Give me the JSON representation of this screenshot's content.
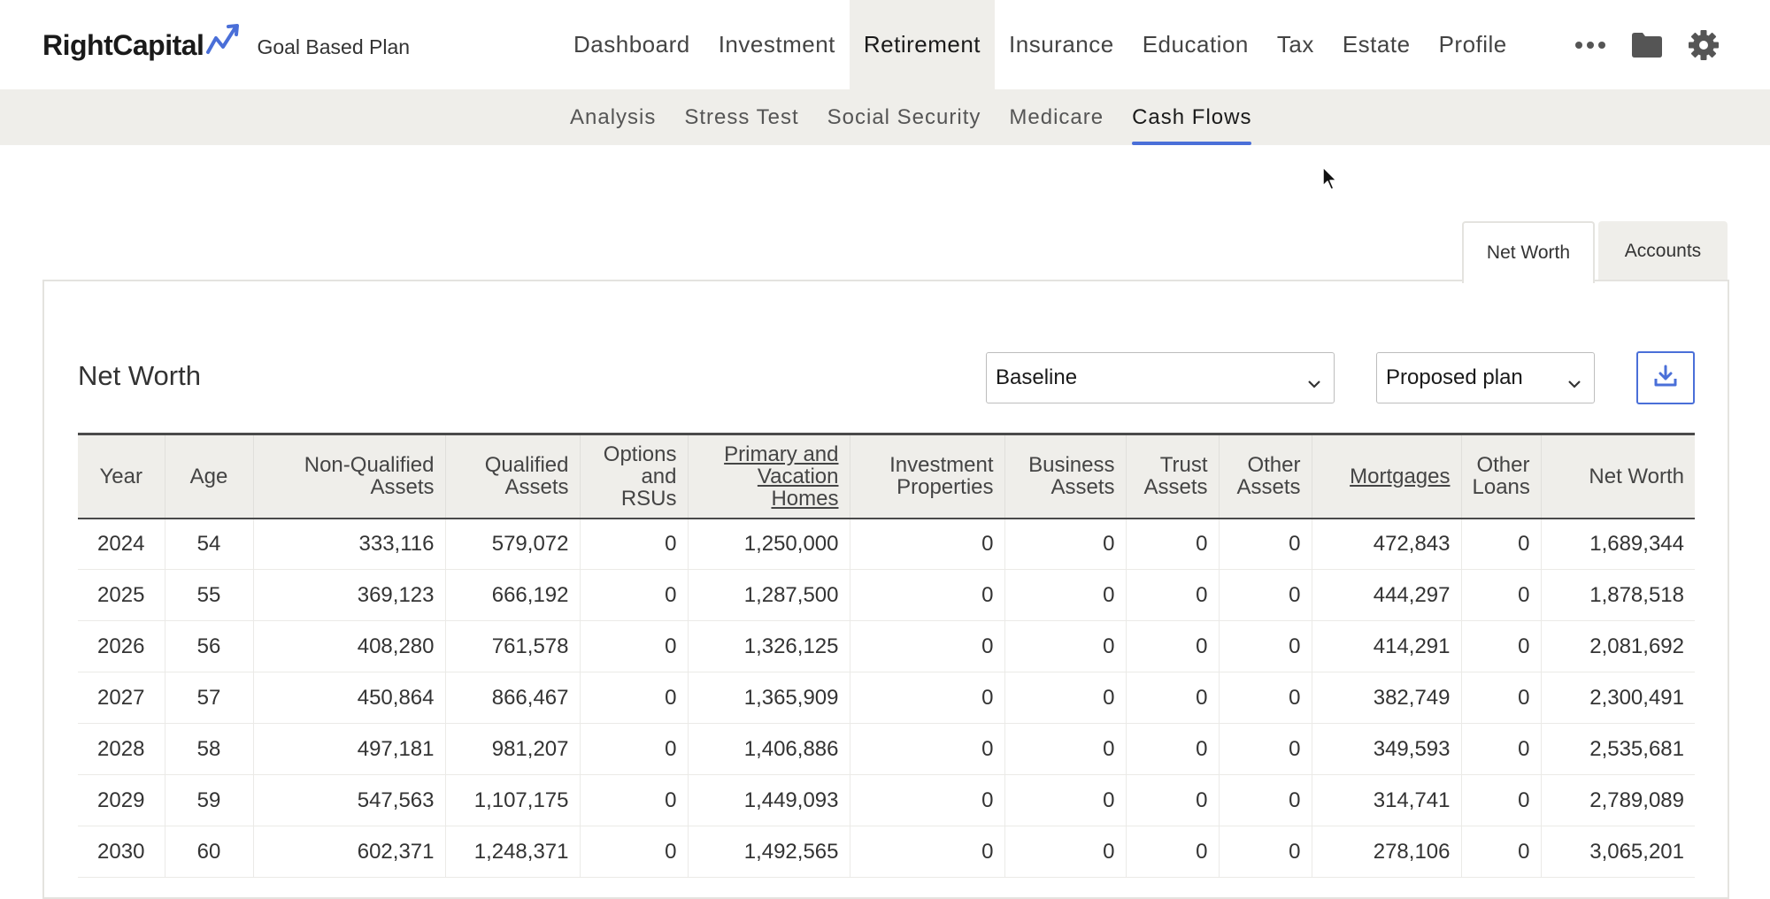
{
  "brand": {
    "logo_text": "RightCapital",
    "plan_name": "Goal Based Plan"
  },
  "main_nav": [
    {
      "label": "Dashboard",
      "active": false
    },
    {
      "label": "Investment",
      "active": false
    },
    {
      "label": "Retirement",
      "active": true
    },
    {
      "label": "Insurance",
      "active": false
    },
    {
      "label": "Education",
      "active": false
    },
    {
      "label": "Tax",
      "active": false
    },
    {
      "label": "Estate",
      "active": false
    },
    {
      "label": "Profile",
      "active": false
    }
  ],
  "nav_icons": [
    "more-icon",
    "folder-icon",
    "gear-icon"
  ],
  "sub_nav": [
    {
      "label": "Analysis",
      "active": false
    },
    {
      "label": "Stress Test",
      "active": false
    },
    {
      "label": "Social Security",
      "active": false
    },
    {
      "label": "Medicare",
      "active": false
    },
    {
      "label": "Cash Flows",
      "active": true
    }
  ],
  "panel_tabs": [
    {
      "label": "Net Worth",
      "active": true
    },
    {
      "label": "Accounts",
      "active": false
    }
  ],
  "panel": {
    "title": "Net Worth",
    "scenario_select": "Baseline",
    "plan_select": "Proposed plan"
  },
  "colors": {
    "accent": "#4a6fd8",
    "subnav_bg": "#efeeea",
    "header_bg": "#efeeea"
  },
  "table": {
    "headers": [
      {
        "label": "Year",
        "link": false
      },
      {
        "label": "Age",
        "link": false
      },
      {
        "label": "Non-Qualified Assets",
        "link": false
      },
      {
        "label": "Qualified Assets",
        "link": false
      },
      {
        "label": "Options and RSUs",
        "link": false
      },
      {
        "label": "Primary and Vacation Homes",
        "link": true
      },
      {
        "label": "Investment Properties",
        "link": false
      },
      {
        "label": "Business Assets",
        "link": false
      },
      {
        "label": "Trust Assets",
        "link": false
      },
      {
        "label": "Other Assets",
        "link": false
      },
      {
        "label": "Mortgages",
        "link": true
      },
      {
        "label": "Other Loans",
        "link": false
      },
      {
        "label": "Net Worth",
        "link": false
      }
    ],
    "rows": [
      [
        "2024",
        "54",
        "333,116",
        "579,072",
        "0",
        "1,250,000",
        "0",
        "0",
        "0",
        "0",
        "472,843",
        "0",
        "1,689,344"
      ],
      [
        "2025",
        "55",
        "369,123",
        "666,192",
        "0",
        "1,287,500",
        "0",
        "0",
        "0",
        "0",
        "444,297",
        "0",
        "1,878,518"
      ],
      [
        "2026",
        "56",
        "408,280",
        "761,578",
        "0",
        "1,326,125",
        "0",
        "0",
        "0",
        "0",
        "414,291",
        "0",
        "2,081,692"
      ],
      [
        "2027",
        "57",
        "450,864",
        "866,467",
        "0",
        "1,365,909",
        "0",
        "0",
        "0",
        "0",
        "382,749",
        "0",
        "2,300,491"
      ],
      [
        "2028",
        "58",
        "497,181",
        "981,207",
        "0",
        "1,406,886",
        "0",
        "0",
        "0",
        "0",
        "349,593",
        "0",
        "2,535,681"
      ],
      [
        "2029",
        "59",
        "547,563",
        "1,107,175",
        "0",
        "1,449,093",
        "0",
        "0",
        "0",
        "0",
        "314,741",
        "0",
        "2,789,089"
      ],
      [
        "2030",
        "60",
        "602,371",
        "1,248,371",
        "0",
        "1,492,565",
        "0",
        "0",
        "0",
        "0",
        "278,106",
        "0",
        "3,065,201"
      ]
    ]
  }
}
